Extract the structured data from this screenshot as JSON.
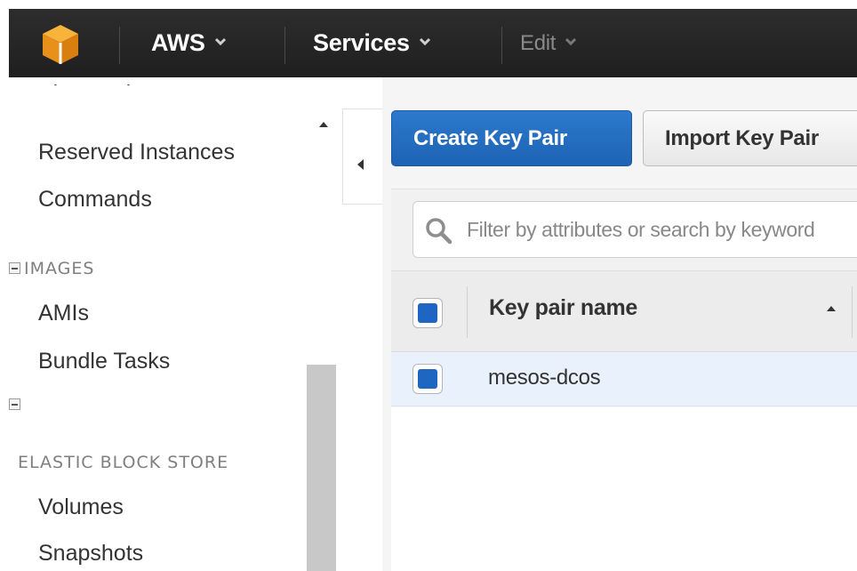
{
  "nav": {
    "brand": "AWS",
    "services": "Services",
    "edit": "Edit",
    "logo_color": "#f19e1f"
  },
  "sidebar": {
    "partial_item": "Spot Requests",
    "items_top": [
      "Reserved Instances",
      "Commands"
    ],
    "images_section": "IMAGES",
    "images_items": [
      "AMIs",
      "Bundle Tasks"
    ],
    "ebs_section": "ELASTIC BLOCK STORE",
    "ebs_items": [
      "Volumes",
      "Snapshots"
    ]
  },
  "toolbar": {
    "create_label": "Create Key Pair",
    "import_label": "Import Key Pair"
  },
  "filter": {
    "placeholder": "Filter by attributes or search by keyword"
  },
  "table": {
    "column_header": "Key pair name",
    "rows": [
      {
        "name": "mesos-dcos"
      }
    ]
  },
  "colors": {
    "primary": "#1f66c2",
    "topbar": "#232323",
    "selected_row": "#e9f2fc"
  }
}
